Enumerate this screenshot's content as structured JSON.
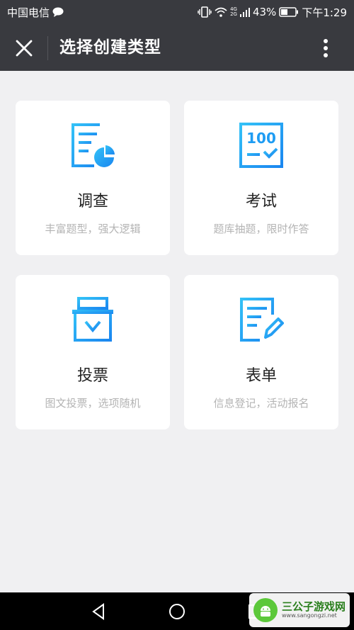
{
  "status_bar": {
    "carrier": "中国电信",
    "network_top": "4G",
    "network_bottom": "2G",
    "battery": "43%",
    "time": "下午1:29"
  },
  "header": {
    "title": "选择创建类型"
  },
  "cards": [
    {
      "title": "调查",
      "desc": "丰富题型，强大逻辑",
      "icon": "survey-icon"
    },
    {
      "title": "考试",
      "desc": "题库抽题，限时作答",
      "icon": "exam-icon"
    },
    {
      "title": "投票",
      "desc": "图文投票，选项随机",
      "icon": "vote-icon"
    },
    {
      "title": "表单",
      "desc": "信息登记，活动报名",
      "icon": "form-icon"
    }
  ],
  "watermark": {
    "name": "三公子游戏网",
    "url": "www.sangongzi.net"
  },
  "colors": {
    "header_bg": "#393a3f",
    "page_bg": "#f0f0f2",
    "icon_blue": "#1ea0f5"
  }
}
